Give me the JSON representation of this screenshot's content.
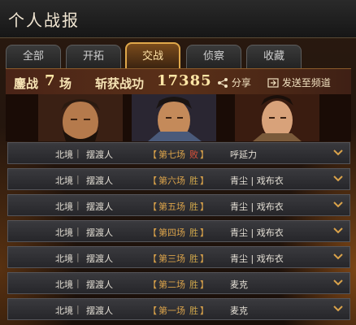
{
  "header": {
    "title": "个人战报"
  },
  "tabs": [
    {
      "label": "全部",
      "active": false
    },
    {
      "label": "开拓",
      "active": false
    },
    {
      "label": "交战",
      "active": true
    },
    {
      "label": "侦察",
      "active": false
    },
    {
      "label": "收藏",
      "active": false
    }
  ],
  "summary": {
    "battles_label": "鏖战",
    "battles_count": "7",
    "battles_unit": "场",
    "merit_label": "斩获战功",
    "merit_value": "17385",
    "share_label": "分享",
    "send_label": "发送至频道"
  },
  "battles": [
    {
      "region": "北境",
      "player": "摆渡人",
      "round": "第七场",
      "result": "败",
      "outcome": "lose",
      "opponent": "呼延力"
    },
    {
      "region": "北境",
      "player": "摆渡人",
      "round": "第六场",
      "result": "胜",
      "outcome": "win",
      "opponent": "青尘 | 戏布衣"
    },
    {
      "region": "北境",
      "player": "摆渡人",
      "round": "第五场",
      "result": "胜",
      "outcome": "win",
      "opponent": "青尘 | 戏布衣"
    },
    {
      "region": "北境",
      "player": "摆渡人",
      "round": "第四场",
      "result": "胜",
      "outcome": "win",
      "opponent": "青尘 | 戏布衣"
    },
    {
      "region": "北境",
      "player": "摆渡人",
      "round": "第三场",
      "result": "胜",
      "outcome": "win",
      "opponent": "青尘 | 戏布衣"
    },
    {
      "region": "北境",
      "player": "摆渡人",
      "round": "第二场",
      "result": "胜",
      "outcome": "win",
      "opponent": "麦克"
    },
    {
      "region": "北境",
      "player": "摆渡人",
      "round": "第一场",
      "result": "胜",
      "outcome": "win",
      "opponent": "麦克"
    }
  ],
  "colors": {
    "accent": "#e0a84a",
    "lose": "#e0523a",
    "win": "#c9a24a"
  }
}
